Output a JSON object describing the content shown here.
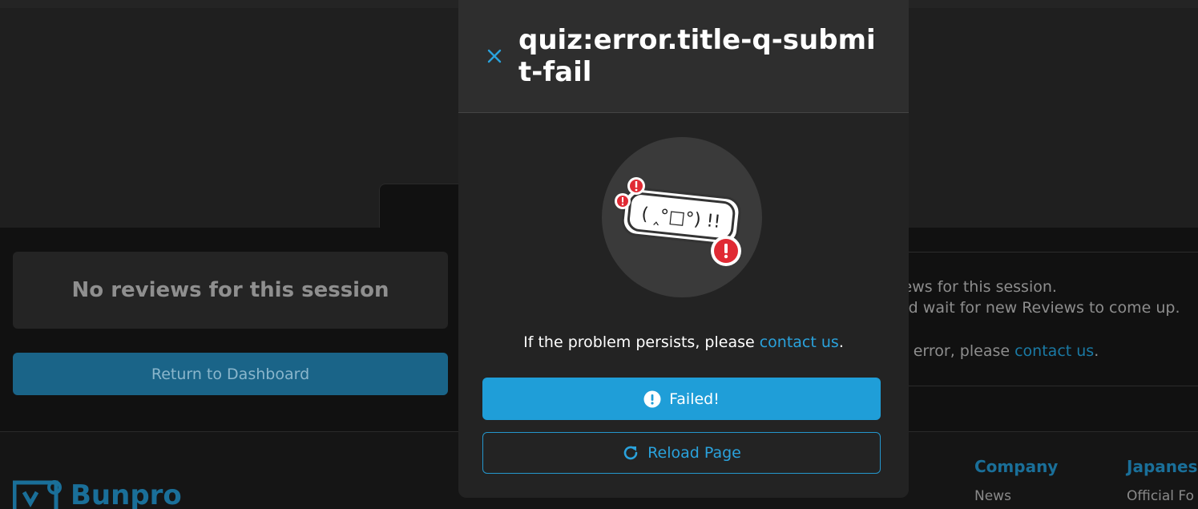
{
  "background": {
    "no_reviews_title": "No reviews for this session",
    "return_button": "Return to Dashboard",
    "right_panel": {
      "line1": "views for this session.",
      "line2": "and wait for new Reviews to come up.",
      "line3_prefix": "an error, please ",
      "line3_link": "contact us",
      "line3_suffix": "."
    },
    "footer": {
      "logo_text": "Bunpro",
      "col1_heading": "Company",
      "col1_item": "News",
      "col2_heading": "Japanese",
      "col2_item": "Official Fo"
    }
  },
  "modal": {
    "title": "quiz:error.title-q-submit-fail",
    "kaomoji": "( ‸°□°) !!",
    "persist_prefix": "If the problem persists, please ",
    "persist_link": "contact us",
    "persist_suffix": ".",
    "failed_button": "Failed!",
    "reload_button": "Reload Page"
  },
  "icons": {
    "close": "close-icon",
    "failed": "exclamation-circle-icon",
    "reload": "reload-icon"
  },
  "colors": {
    "accent": "#1f9ed8",
    "link": "#2aa2dc",
    "alert_red": "#e02a34"
  }
}
